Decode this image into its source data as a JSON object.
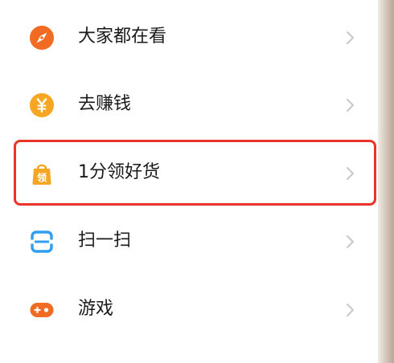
{
  "menu": {
    "items": [
      {
        "label": "大家都在看",
        "icon": "compass-icon"
      },
      {
        "label": "去赚钱",
        "icon": "yuan-coin-icon"
      },
      {
        "label": "1分领好货",
        "icon": "shopping-bag-icon",
        "icon_text": "领"
      },
      {
        "label": "扫一扫",
        "icon": "scan-icon"
      },
      {
        "label": "游戏",
        "icon": "gamepad-icon"
      }
    ],
    "highlighted_index": 2
  },
  "colors": {
    "orange": "#f26b22",
    "amber": "#f5a623",
    "blue": "#2f9df0",
    "highlight_border": "#e8342a",
    "chevron": "#c7c7c7",
    "text": "#1a1a1a"
  }
}
